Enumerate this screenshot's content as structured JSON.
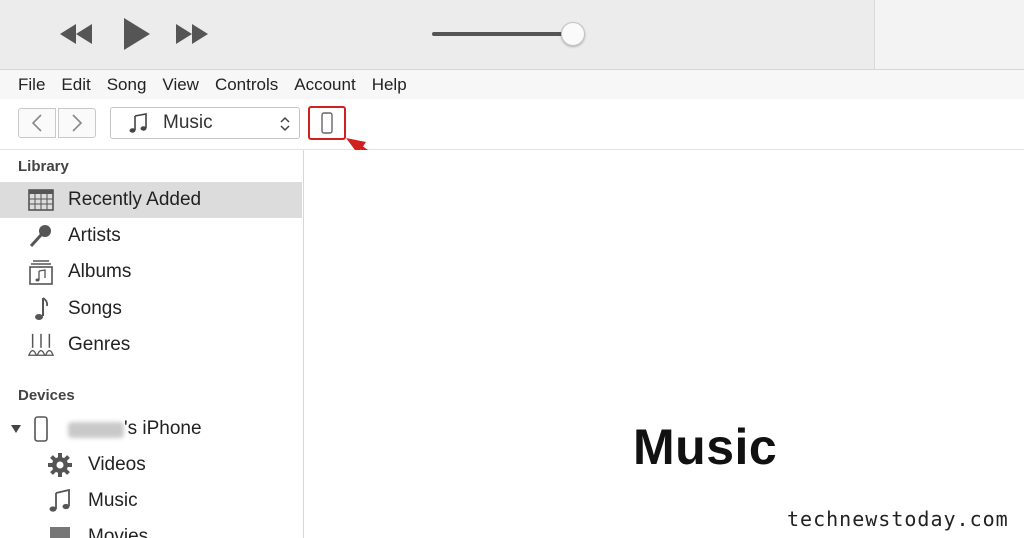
{
  "player": {
    "rewind_icon": "rewind-icon",
    "play_icon": "play-icon",
    "fast_forward_icon": "fast-forward-icon"
  },
  "menu": {
    "items": [
      "File",
      "Edit",
      "Song",
      "View",
      "Controls",
      "Account",
      "Help"
    ]
  },
  "toolbar": {
    "back_icon": "chevron-left-icon",
    "forward_icon": "chevron-right-icon",
    "media_select_value": "Music",
    "device_icon": "iphone-icon"
  },
  "sidebar": {
    "library_heading": "Library",
    "library_items": [
      {
        "label": "Recently Added",
        "icon": "calendar-grid-icon",
        "selected": true
      },
      {
        "label": "Artists",
        "icon": "microphone-icon"
      },
      {
        "label": "Albums",
        "icon": "album-icon"
      },
      {
        "label": "Songs",
        "icon": "music-note-icon"
      },
      {
        "label": "Genres",
        "icon": "guitars-icon"
      }
    ],
    "devices_heading": "Devices",
    "device_name": "'s iPhone",
    "device_items": [
      {
        "label": "Videos",
        "icon": "gear-icon"
      },
      {
        "label": "Music",
        "icon": "music-note-icon"
      },
      {
        "label": "Movies",
        "icon": "film-icon"
      }
    ]
  },
  "main": {
    "title": "Music"
  },
  "watermark": "technewstoday.com",
  "colors": {
    "highlight_red": "#d21f1f",
    "selected_row": "#dcdcdc"
  }
}
